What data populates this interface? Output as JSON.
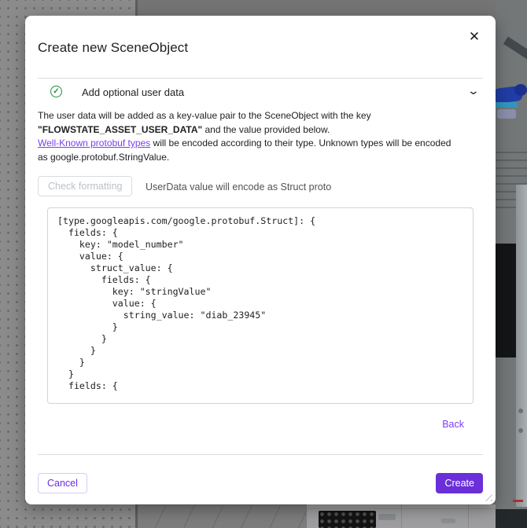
{
  "modal": {
    "title": "Create new SceneObject",
    "section": {
      "label": "Add optional user data"
    },
    "description": {
      "line1": "The user data will be added as a key-value pair to the SceneObject with the key",
      "key_bold": "\"FLOWSTATE_ASSET_USER_DATA\"",
      "line2_rest": " and the value provided below.",
      "link_text": "Well-Known protobuf types",
      "line3_rest": " will be encoded according to their type. Unknown types will be encoded",
      "line4": "as google.protobuf.StringValue."
    },
    "format_check": {
      "button_label": "Check formatting",
      "status_text": "UserData value will encode as Struct proto"
    },
    "code_editor": {
      "content": "[type.googleapis.com/google.protobuf.Struct]: {\n  fields: {\n    key: \"model_number\"\n    value: {\n      struct_value: {\n        fields: {\n          key: \"stringValue\"\n          value: {\n            string_value: \"diab_23945\"\n          }\n        }\n      }\n    }\n  }\n  fields: {"
    },
    "back_label": "Back",
    "footer": {
      "cancel_label": "Cancel",
      "create_label": "Create"
    }
  },
  "icons": {
    "close": "✕",
    "check": "✓",
    "chevron_down": "⌄"
  },
  "colors": {
    "accent_purple": "#6b2fd9",
    "link_purple": "#7a3ff2",
    "success_green": "#1e8e3e"
  }
}
